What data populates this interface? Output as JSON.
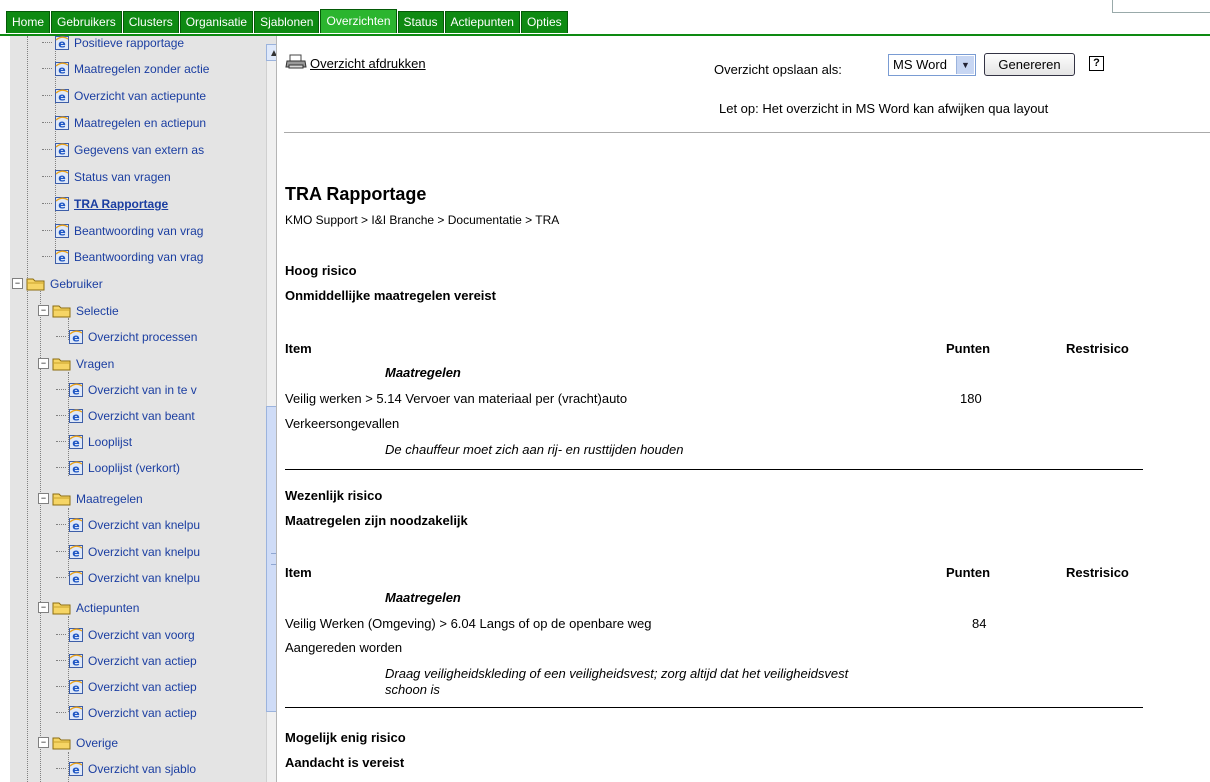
{
  "nav": {
    "tabs": [
      {
        "label": "Home"
      },
      {
        "label": "Gebruikers"
      },
      {
        "label": "Clusters"
      },
      {
        "label": "Organisatie"
      },
      {
        "label": "Sjablonen"
      },
      {
        "label": "Overzichten",
        "active": true
      },
      {
        "label": "Status"
      },
      {
        "label": "Actiepunten"
      },
      {
        "label": "Opties"
      }
    ],
    "accent_color": "#0e8a12"
  },
  "sidebar": {
    "items": [
      {
        "label": "Positieve rapportage",
        "type": "doc"
      },
      {
        "label": "Maatregelen zonder actie",
        "type": "doc"
      },
      {
        "label": "Overzicht van actiepunte",
        "type": "doc"
      },
      {
        "label": "Maatregelen en actiepun",
        "type": "doc"
      },
      {
        "label": "Gegevens van extern as",
        "type": "doc"
      },
      {
        "label": "Status van vragen",
        "type": "doc"
      },
      {
        "label": "TRA Rapportage",
        "type": "doc",
        "active": true
      },
      {
        "label": "Beantwoording van vrag",
        "type": "doc"
      },
      {
        "label": "Beantwoording van vrag",
        "type": "doc"
      },
      {
        "label": "Gebruiker",
        "type": "folder"
      },
      {
        "label": "Selectie",
        "type": "folder"
      },
      {
        "label": "Overzicht processen",
        "type": "doc"
      },
      {
        "label": "Vragen",
        "type": "folder"
      },
      {
        "label": "Overzicht van in te v",
        "type": "doc"
      },
      {
        "label": "Overzicht van beant",
        "type": "doc"
      },
      {
        "label": "Looplijst",
        "type": "doc"
      },
      {
        "label": "Looplijst (verkort)",
        "type": "doc"
      },
      {
        "label": "Maatregelen",
        "type": "folder"
      },
      {
        "label": "Overzicht van knelpu",
        "type": "doc"
      },
      {
        "label": "Overzicht van knelpu",
        "type": "doc"
      },
      {
        "label": "Overzicht van knelpu",
        "type": "doc"
      },
      {
        "label": "Actiepunten",
        "type": "folder"
      },
      {
        "label": "Overzicht van voorg",
        "type": "doc"
      },
      {
        "label": "Overzicht van actiep",
        "type": "doc"
      },
      {
        "label": "Overzicht van actiep",
        "type": "doc"
      },
      {
        "label": "Overzicht van actiep",
        "type": "doc"
      },
      {
        "label": "Overige",
        "type": "folder"
      },
      {
        "label": "Overzicht van sjablo",
        "type": "doc"
      }
    ]
  },
  "toolbar": {
    "print_label": "Overzicht afdrukken",
    "save_as_label": "Overzicht opslaan als:",
    "format_value": "MS Word",
    "generate_label": "Genereren",
    "help_label": "?",
    "notice": "Let op: Het overzicht in MS Word kan afwijken qua layout"
  },
  "report": {
    "title": "TRA Rapportage",
    "breadcrumb": "KMO Support > I&I Branche > Documentatie > TRA",
    "sections": [
      {
        "risk": "Hoog risico",
        "requirement": "Onmiddellijke maatregelen vereist",
        "col_item": "Item",
        "col_points": "Punten",
        "col_rest": "Restrisico",
        "measures_label": "Maatregelen",
        "item": "Veilig werken > 5.14 Vervoer van materiaal per (vracht)auto",
        "points": "180",
        "hazard": "Verkeersongevallen",
        "measure": "De chauffeur moet zich aan rij- en rusttijden houden"
      },
      {
        "risk": "Wezenlijk risico",
        "requirement": "Maatregelen zijn noodzakelijk",
        "col_item": "Item",
        "col_points": "Punten",
        "col_rest": "Restrisico",
        "measures_label": "Maatregelen",
        "item": "Veilig Werken (Omgeving) > 6.04 Langs of op de openbare weg",
        "points": "84",
        "hazard": "Aangereden worden",
        "measure_line1": "Draag veiligheidskleding of een veiligheidsvest; zorg altijd dat het veiligheidsvest",
        "measure_line2": "schoon is"
      },
      {
        "risk": "Mogelijk enig risico",
        "requirement": "Aandacht is vereist"
      }
    ]
  }
}
